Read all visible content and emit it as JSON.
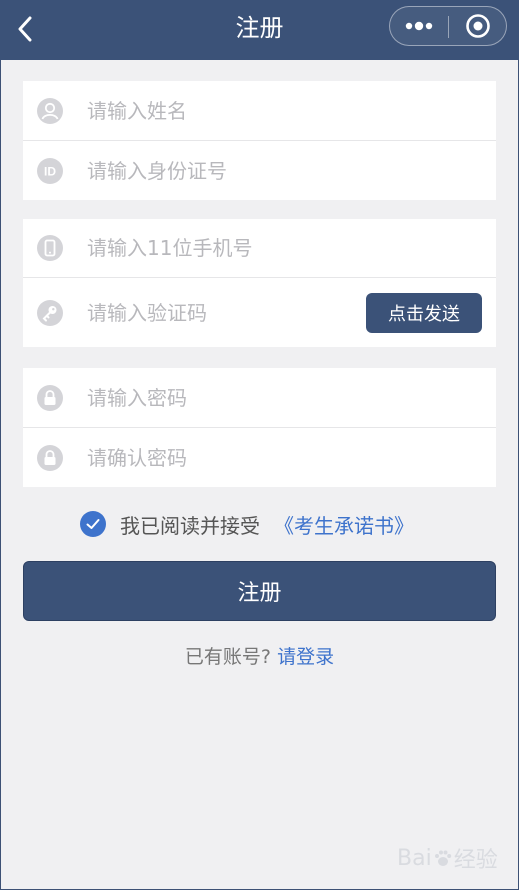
{
  "header": {
    "title": "注册",
    "back_icon": "chevron-left-icon",
    "more_icon": "more-dots-icon",
    "close_icon": "target-close-icon",
    "bg_color": "#3b5278"
  },
  "identity": {
    "name_placeholder": "请输入姓名",
    "idcard_placeholder": "请输入身份证号",
    "idcard_icon_text": "ID"
  },
  "phone": {
    "phone_placeholder": "请输入11位手机号",
    "code_placeholder": "请输入验证码",
    "send_button": "点击发送"
  },
  "password": {
    "password_placeholder": "请输入密码",
    "confirm_placeholder": "请确认密码"
  },
  "agreement": {
    "checked": true,
    "text": "我已阅读并接受",
    "link": "《考生承诺书》"
  },
  "submit_button": "注册",
  "login": {
    "prompt": "已有账号?",
    "link": "请登录"
  },
  "watermark": {
    "brand": "Bai",
    "suffix": "经验"
  },
  "colors": {
    "accent": "#3b5278",
    "link": "#3e73cc",
    "background": "#f0f0f2"
  }
}
